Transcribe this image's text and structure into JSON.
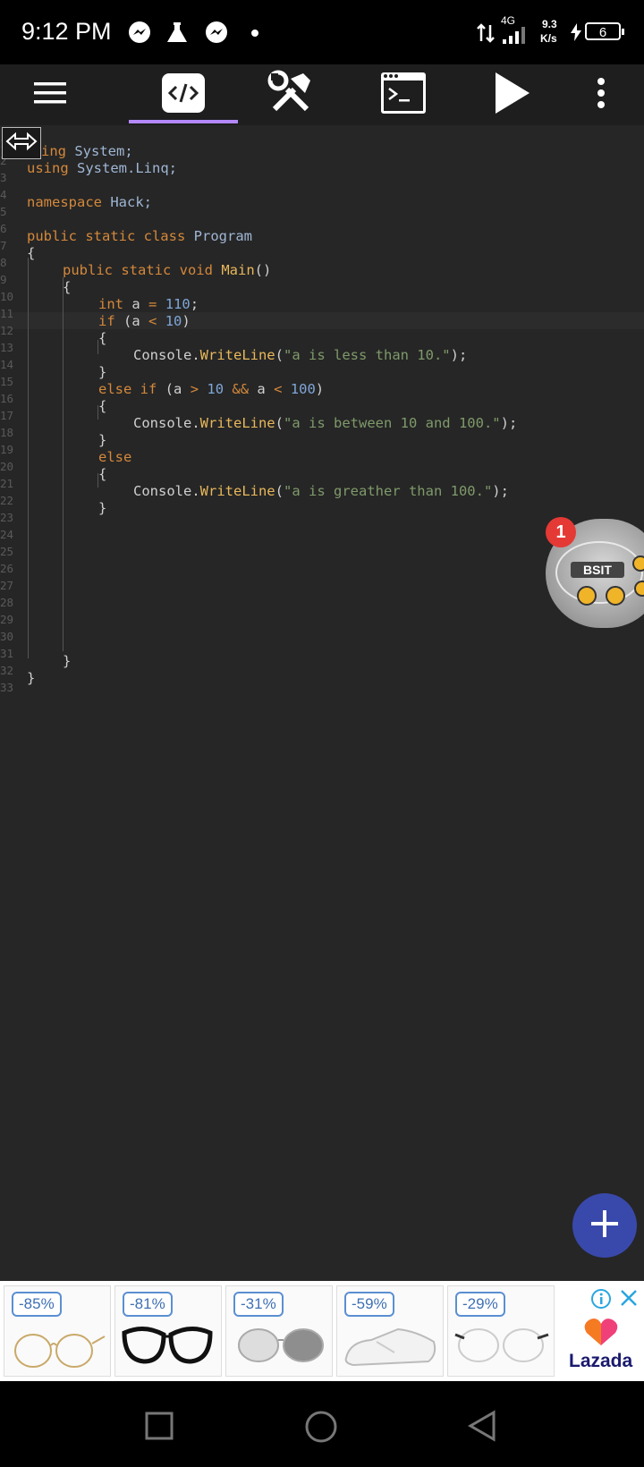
{
  "status_bar": {
    "time": "9:12 PM",
    "network": "4G",
    "speed_value": "9.3",
    "speed_unit": "K/s",
    "battery": "6"
  },
  "toolbar": {
    "menu_icon": "hamburger-menu-icon",
    "code_tab_icon": "code-tag-icon",
    "tools_icon": "wrench-hammer-icon",
    "terminal_icon": "terminal-icon",
    "run_icon": "play-icon",
    "overflow_icon": "more-vertical-icon",
    "active_tab_color": "#b388ff"
  },
  "editor": {
    "line_numbers": [
      "1",
      "2",
      "3",
      "4",
      "5",
      "6",
      "7",
      "8",
      "9",
      "10",
      "11",
      "12",
      "13",
      "14",
      "15",
      "16",
      "17",
      "18",
      "19",
      "20",
      "21",
      "22",
      "23",
      "24",
      "25",
      "26",
      "27",
      "28",
      "29",
      "30",
      "31",
      "32",
      "33"
    ],
    "code": {
      "l1_kw": "ing",
      "l1_rest": "System;",
      "l2_kw": "using",
      "l2_rest": "System.Linq;",
      "l4_kw": "namespace",
      "l4_rest": "Hack;",
      "l6_kw": "public static class",
      "l6_rest": "Program",
      "l7": "{",
      "l8_kw": "public static void",
      "l8_m": "Main",
      "l8_rest": "()",
      "l9": "{",
      "l10_kw": "int",
      "l10_a": "a",
      "l10_eq": "=",
      "l10_num": "110",
      "l10_end": ";",
      "l11_kw": "if",
      "l11_a": "(a",
      "l11_op": "<",
      "l11_num": "10",
      "l11_end": ")",
      "l12": "{",
      "l13_c": "Console.",
      "l13_m": "WriteLine",
      "l13_p": "(",
      "l13_s": "\"a is less than 10.\"",
      "l13_e": ");",
      "l14": "}",
      "l15_kw": "else if",
      "l15_a": "(a",
      "l15_op1": ">",
      "l15_n1": "10",
      "l15_op2": "&&",
      "l15_b": "a",
      "l15_op3": "<",
      "l15_n2": "100",
      "l15_end": ")",
      "l16": "{",
      "l17_c": "Console.",
      "l17_m": "WriteLine",
      "l17_p": "(",
      "l17_s": "\"a is between 10 and 100.\"",
      "l17_e": ");",
      "l18": "}",
      "l19_kw": "else",
      "l20": "{",
      "l21_c": "Console.",
      "l21_m": "WriteLine",
      "l21_p": "(",
      "l21_s": "\"a is greather than 100.\"",
      "l21_e": ");",
      "l22": "}",
      "l31": "}",
      "l32": "}"
    }
  },
  "floating_bubble": {
    "badge_count": "1",
    "logo_text": "BSIT"
  },
  "fab": {
    "icon": "plus-icon",
    "color": "#3949ab"
  },
  "ad": {
    "discounts": [
      "-85%",
      "-81%",
      "-31%",
      "-59%",
      "-29%"
    ],
    "brand": "Lazada"
  },
  "nav_bar": {
    "recent_icon": "square-recents-icon",
    "home_icon": "circle-home-icon",
    "back_icon": "triangle-back-icon"
  }
}
